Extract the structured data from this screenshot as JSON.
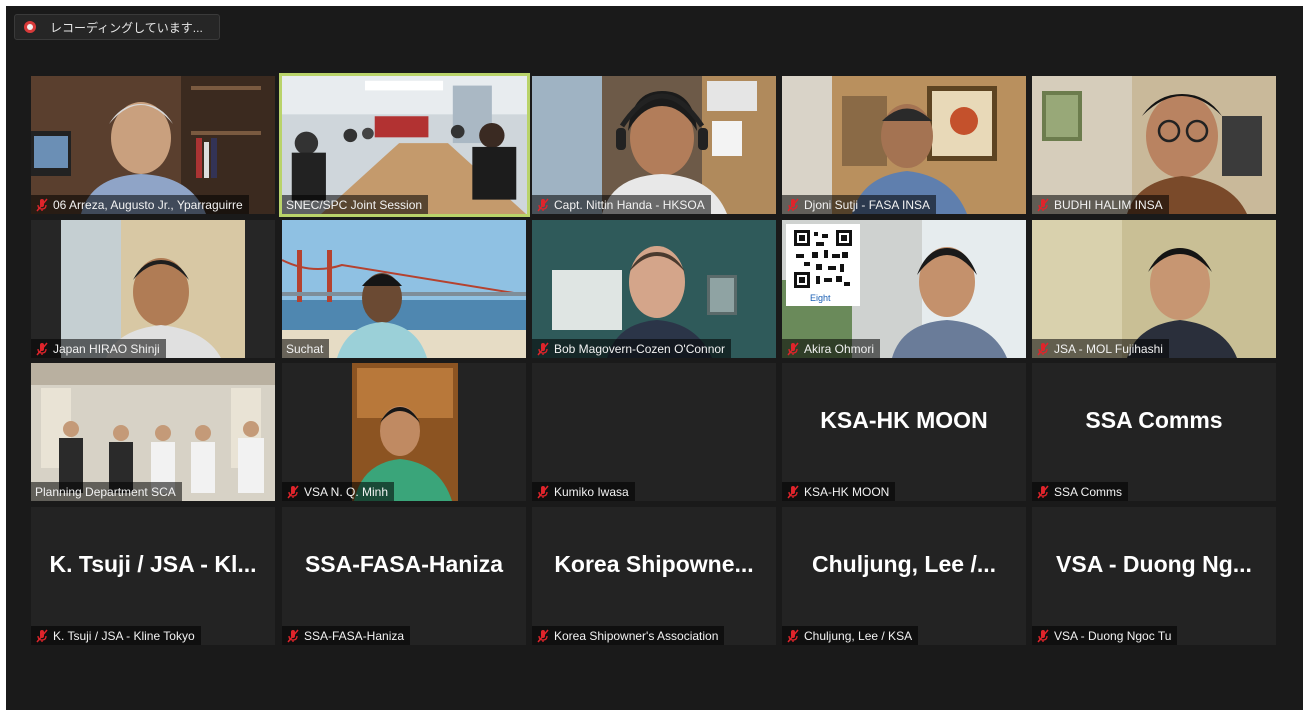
{
  "recording": {
    "label": "レコーディングしています..."
  },
  "tiles": [
    {
      "name": "06 Arreza, Augusto Jr., Yparraguirre",
      "muted": true,
      "video": true
    },
    {
      "name": "SNEC/SPC Joint Session",
      "muted": false,
      "video": true,
      "active": true
    },
    {
      "name": "Capt. Nittin Handa - HKSOA",
      "muted": true,
      "video": true
    },
    {
      "name": "Djoni Sutji - FASA INSA",
      "muted": true,
      "video": true
    },
    {
      "name": "BUDHI HALIM INSA",
      "muted": true,
      "video": true
    },
    {
      "name": "Japan HIRAO Shinji",
      "muted": true,
      "video": true
    },
    {
      "name": "Suchat",
      "muted": false,
      "video": true
    },
    {
      "name": "Bob Magovern-Cozen O'Connor",
      "muted": true,
      "video": true
    },
    {
      "name": "Akira Ohmori",
      "muted": true,
      "video": true,
      "qr_label": "Eight"
    },
    {
      "name": "JSA - MOL Fujihashi",
      "muted": true,
      "video": true
    },
    {
      "name": "Planning Department SCA",
      "muted": false,
      "video": true
    },
    {
      "name": "VSA N. Q. Minh",
      "muted": true,
      "video": true
    },
    {
      "name": "Kumiko Iwasa",
      "muted": true,
      "video": false,
      "display": ""
    },
    {
      "name": "KSA-HK MOON",
      "muted": true,
      "video": false,
      "display": "KSA-HK MOON"
    },
    {
      "name": "SSA Comms",
      "muted": true,
      "video": false,
      "display": "SSA Comms"
    },
    {
      "name": "K. Tsuji / JSA - Kline Tokyo",
      "muted": true,
      "video": false,
      "display": "K. Tsuji / JSA - Kl..."
    },
    {
      "name": "SSA-FASA-Haniza",
      "muted": true,
      "video": false,
      "display": "SSA-FASA-Haniza"
    },
    {
      "name": "Korea Shipowner's Association",
      "muted": true,
      "video": false,
      "display": "Korea  Shipowne..."
    },
    {
      "name": "Chuljung, Lee / KSA",
      "muted": true,
      "video": false,
      "display": "Chuljung, Lee /..."
    },
    {
      "name": "VSA - Duong Ngoc Tu",
      "muted": true,
      "video": false,
      "display": "VSA - Duong Ng..."
    }
  ],
  "colors": {
    "muted_icon": "#e0242b",
    "active_border": "#b9d36a",
    "background": "#1a1a1a"
  },
  "icons": {
    "record": "record-dot-icon",
    "muted": "mic-muted-icon"
  }
}
